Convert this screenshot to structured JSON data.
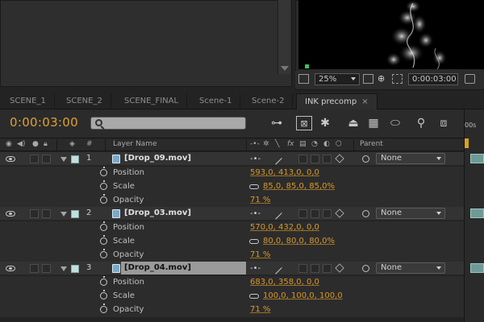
{
  "viewer": {
    "zoom": "25%",
    "timecode": "0:00:03:00"
  },
  "tabs": [
    {
      "label": "SCENE_1"
    },
    {
      "label": "SCENE_2"
    },
    {
      "label": "SCENE_FINAL"
    },
    {
      "label": "Scene-1"
    },
    {
      "label": "Scene-2"
    },
    {
      "label": "INK precomp",
      "close": "×"
    }
  ],
  "timeline": {
    "timecode": "0:00:03:00",
    "search_placeholder": "",
    "ruler_label": "00s"
  },
  "columns": {
    "number": "#",
    "layer_name": "Layer Name",
    "parent": "Parent"
  },
  "layers": [
    {
      "number": "1",
      "name": "[Drop_09.mov]",
      "parent": "None",
      "props": [
        {
          "name": "Position",
          "value": "593,0, 413,0, 0,0"
        },
        {
          "name": "Scale",
          "value": "85,0, 85,0, 85,0%"
        },
        {
          "name": "Opacity",
          "value": "71 %"
        }
      ]
    },
    {
      "number": "2",
      "name": "[Drop_03.mov]",
      "parent": "None",
      "props": [
        {
          "name": "Position",
          "value": "570,0, 432,0, 0,0"
        },
        {
          "name": "Scale",
          "value": "80,0, 80,0, 80,0%"
        },
        {
          "name": "Opacity",
          "value": "71 %"
        }
      ]
    },
    {
      "number": "3",
      "name": "[Drop_04.mov]",
      "parent": "None",
      "selected": true,
      "props": [
        {
          "name": "Position",
          "value": "683,0, 358,0, 0,0"
        },
        {
          "name": "Scale",
          "value": "100,0, 100,0, 100,0"
        },
        {
          "name": "Opacity",
          "value": "71 %"
        }
      ]
    }
  ],
  "colors": {
    "timecode": "#e0a030",
    "value": "#d89a2a",
    "label": "#bfe0dc"
  }
}
